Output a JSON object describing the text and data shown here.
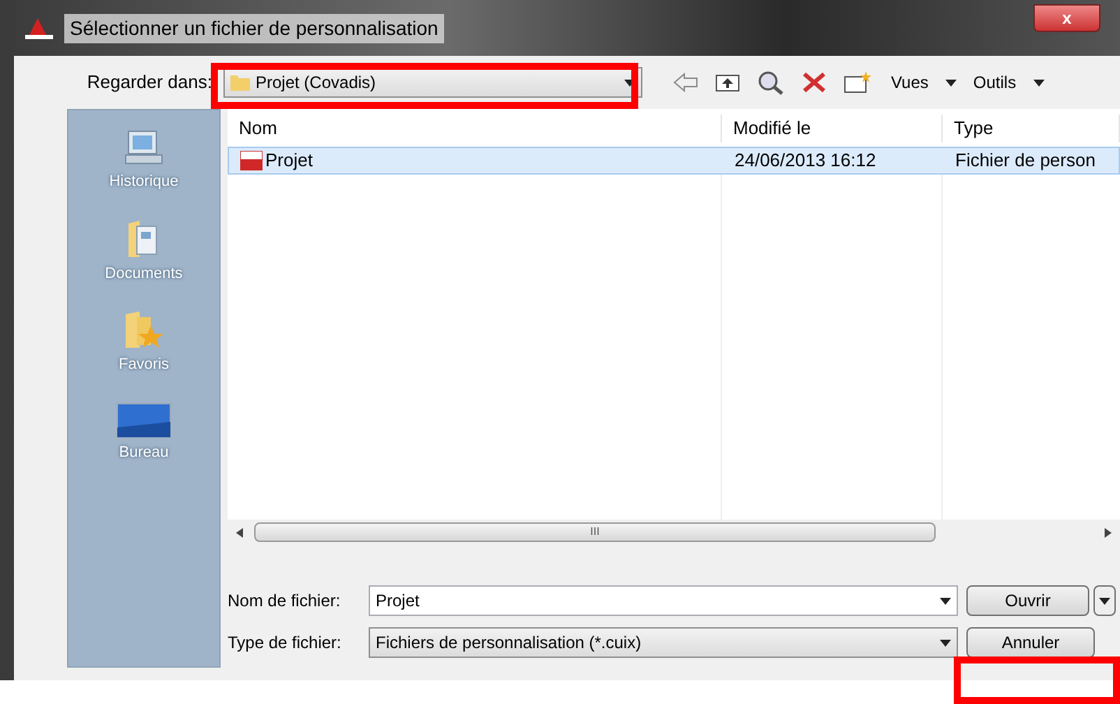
{
  "window": {
    "title": "Sélectionner un fichier de personnalisation",
    "close": "x"
  },
  "look_in": {
    "label": "Regarder dans:",
    "value": "Projet (Covadis)"
  },
  "toolbar": {
    "views": "Vues",
    "tools": "Outils"
  },
  "sidebar": {
    "items": [
      {
        "label": "Historique",
        "kind": "history",
        "selected": false
      },
      {
        "label": "Documents",
        "kind": "documents",
        "selected": false
      },
      {
        "label": "Favoris",
        "kind": "favorites",
        "selected": false
      },
      {
        "label": "Bureau",
        "kind": "desktop",
        "selected": false
      }
    ]
  },
  "table": {
    "columns": [
      "Nom",
      "Modifié le",
      "Type"
    ],
    "rows": [
      {
        "cells": [
          "Projet",
          "24/06/2013 16:12",
          "Fichier de person"
        ],
        "selected": true
      }
    ]
  },
  "scrollbar": {
    "grip": "III"
  },
  "filename": {
    "label": "Nom de fichier:",
    "value": "Projet"
  },
  "filetype": {
    "label": "Type de fichier:",
    "value": "Fichiers de personnalisation (*.cuix)"
  },
  "buttons": [
    "Ouvrir",
    "Annuler"
  ]
}
